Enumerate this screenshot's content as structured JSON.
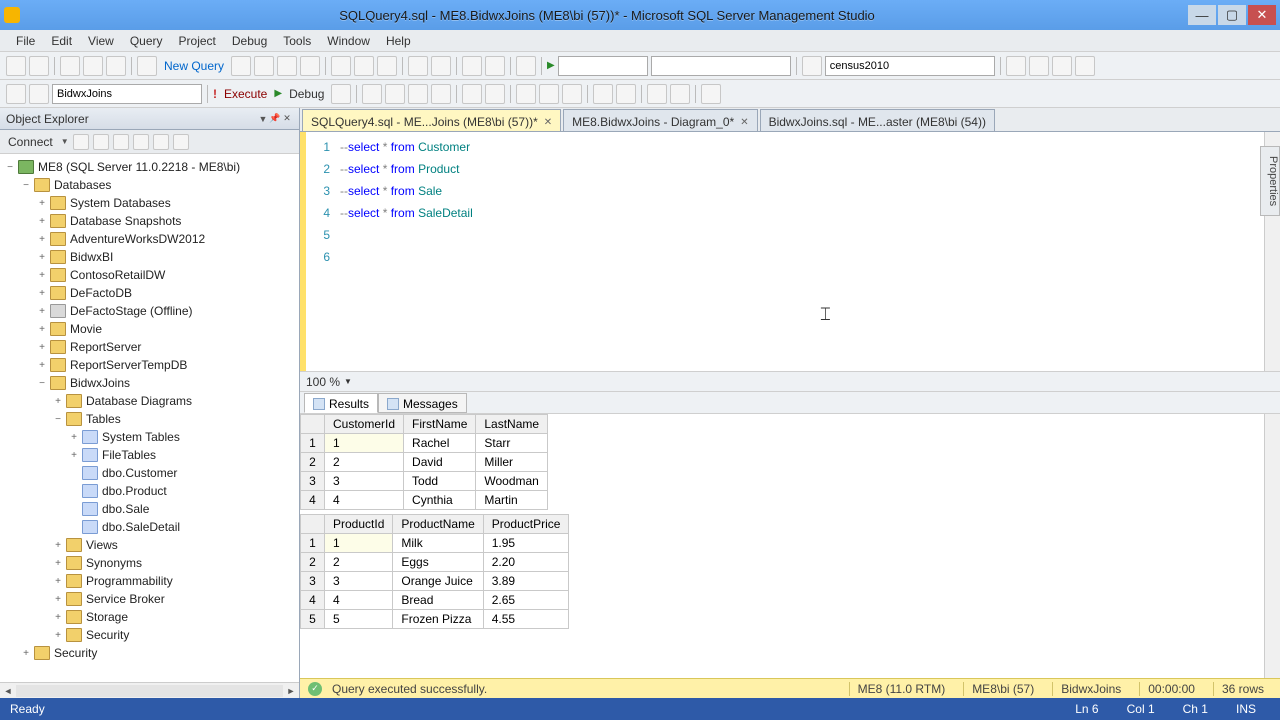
{
  "title": "SQLQuery4.sql - ME8.BidwxJoins (ME8\\bi (57))* - Microsoft SQL Server Management Studio",
  "menu": [
    "File",
    "Edit",
    "View",
    "Query",
    "Project",
    "Debug",
    "Tools",
    "Window",
    "Help"
  ],
  "toolbar1": {
    "new_query": "New Query",
    "combo": "census2010"
  },
  "toolbar2": {
    "db_combo": "BidwxJoins",
    "execute": "Execute",
    "debug": "Debug"
  },
  "object_explorer": {
    "title": "Object Explorer",
    "connect": "Connect",
    "server": "ME8 (SQL Server 11.0.2218 - ME8\\bi)",
    "databases_label": "Databases",
    "sysdb": "System Databases",
    "snap": "Database Snapshots",
    "dbs": [
      "AdventureWorksDW2012",
      "BidwxBI",
      "ContosoRetailDW",
      "DeFactoDB",
      "DeFactoStage (Offline)",
      "Movie",
      "ReportServer",
      "ReportServerTempDB",
      "BidwxJoins"
    ],
    "bj_children": [
      "Database Diagrams",
      "Tables"
    ],
    "tables_children": [
      "System Tables",
      "FileTables",
      "dbo.Customer",
      "dbo.Product",
      "dbo.Sale",
      "dbo.SaleDetail"
    ],
    "bj_rest": [
      "Views",
      "Synonyms",
      "Programmability",
      "Service Broker",
      "Storage",
      "Security"
    ],
    "top_security": "Security"
  },
  "tabs": [
    {
      "label": "SQLQuery4.sql - ME...Joins (ME8\\bi (57))*",
      "active": true,
      "close": true
    },
    {
      "label": "ME8.BidwxJoins - Diagram_0*",
      "active": false,
      "close": true
    },
    {
      "label": "BidwxJoins.sql - ME...aster (ME8\\bi (54))",
      "active": false,
      "close": false
    }
  ],
  "editor": {
    "lines": [
      "--select * from Customer",
      "--select * from Product",
      "--select * from Sale",
      "--select * from SaleDetail",
      "",
      ""
    ],
    "line_numbers": [
      "1",
      "2",
      "3",
      "4",
      "5",
      "6"
    ]
  },
  "zoom": "100 %",
  "result_tabs": {
    "results": "Results",
    "messages": "Messages"
  },
  "grid1": {
    "cols": [
      "CustomerId",
      "FirstName",
      "LastName"
    ],
    "rows": [
      [
        "1",
        "Rachel",
        "Starr"
      ],
      [
        "2",
        "David",
        "Miller"
      ],
      [
        "3",
        "Todd",
        "Woodman"
      ],
      [
        "4",
        "Cynthia",
        "Martin"
      ]
    ]
  },
  "grid2": {
    "cols": [
      "ProductId",
      "ProductName",
      "ProductPrice"
    ],
    "rows": [
      [
        "1",
        "Milk",
        "1.95"
      ],
      [
        "2",
        "Eggs",
        "2.20"
      ],
      [
        "3",
        "Orange Juice",
        "3.89"
      ],
      [
        "4",
        "Bread",
        "2.65"
      ],
      [
        "5",
        "Frozen Pizza",
        "4.55"
      ]
    ]
  },
  "query_status": {
    "msg": "Query executed successfully.",
    "server": "ME8 (11.0 RTM)",
    "login": "ME8\\bi (57)",
    "db": "BidwxJoins",
    "time": "00:00:00",
    "rows": "36 rows"
  },
  "statusbar": {
    "ready": "Ready",
    "ln": "Ln 6",
    "col": "Col 1",
    "ch": "Ch 1",
    "ins": "INS"
  },
  "properties_tab": "Properties"
}
